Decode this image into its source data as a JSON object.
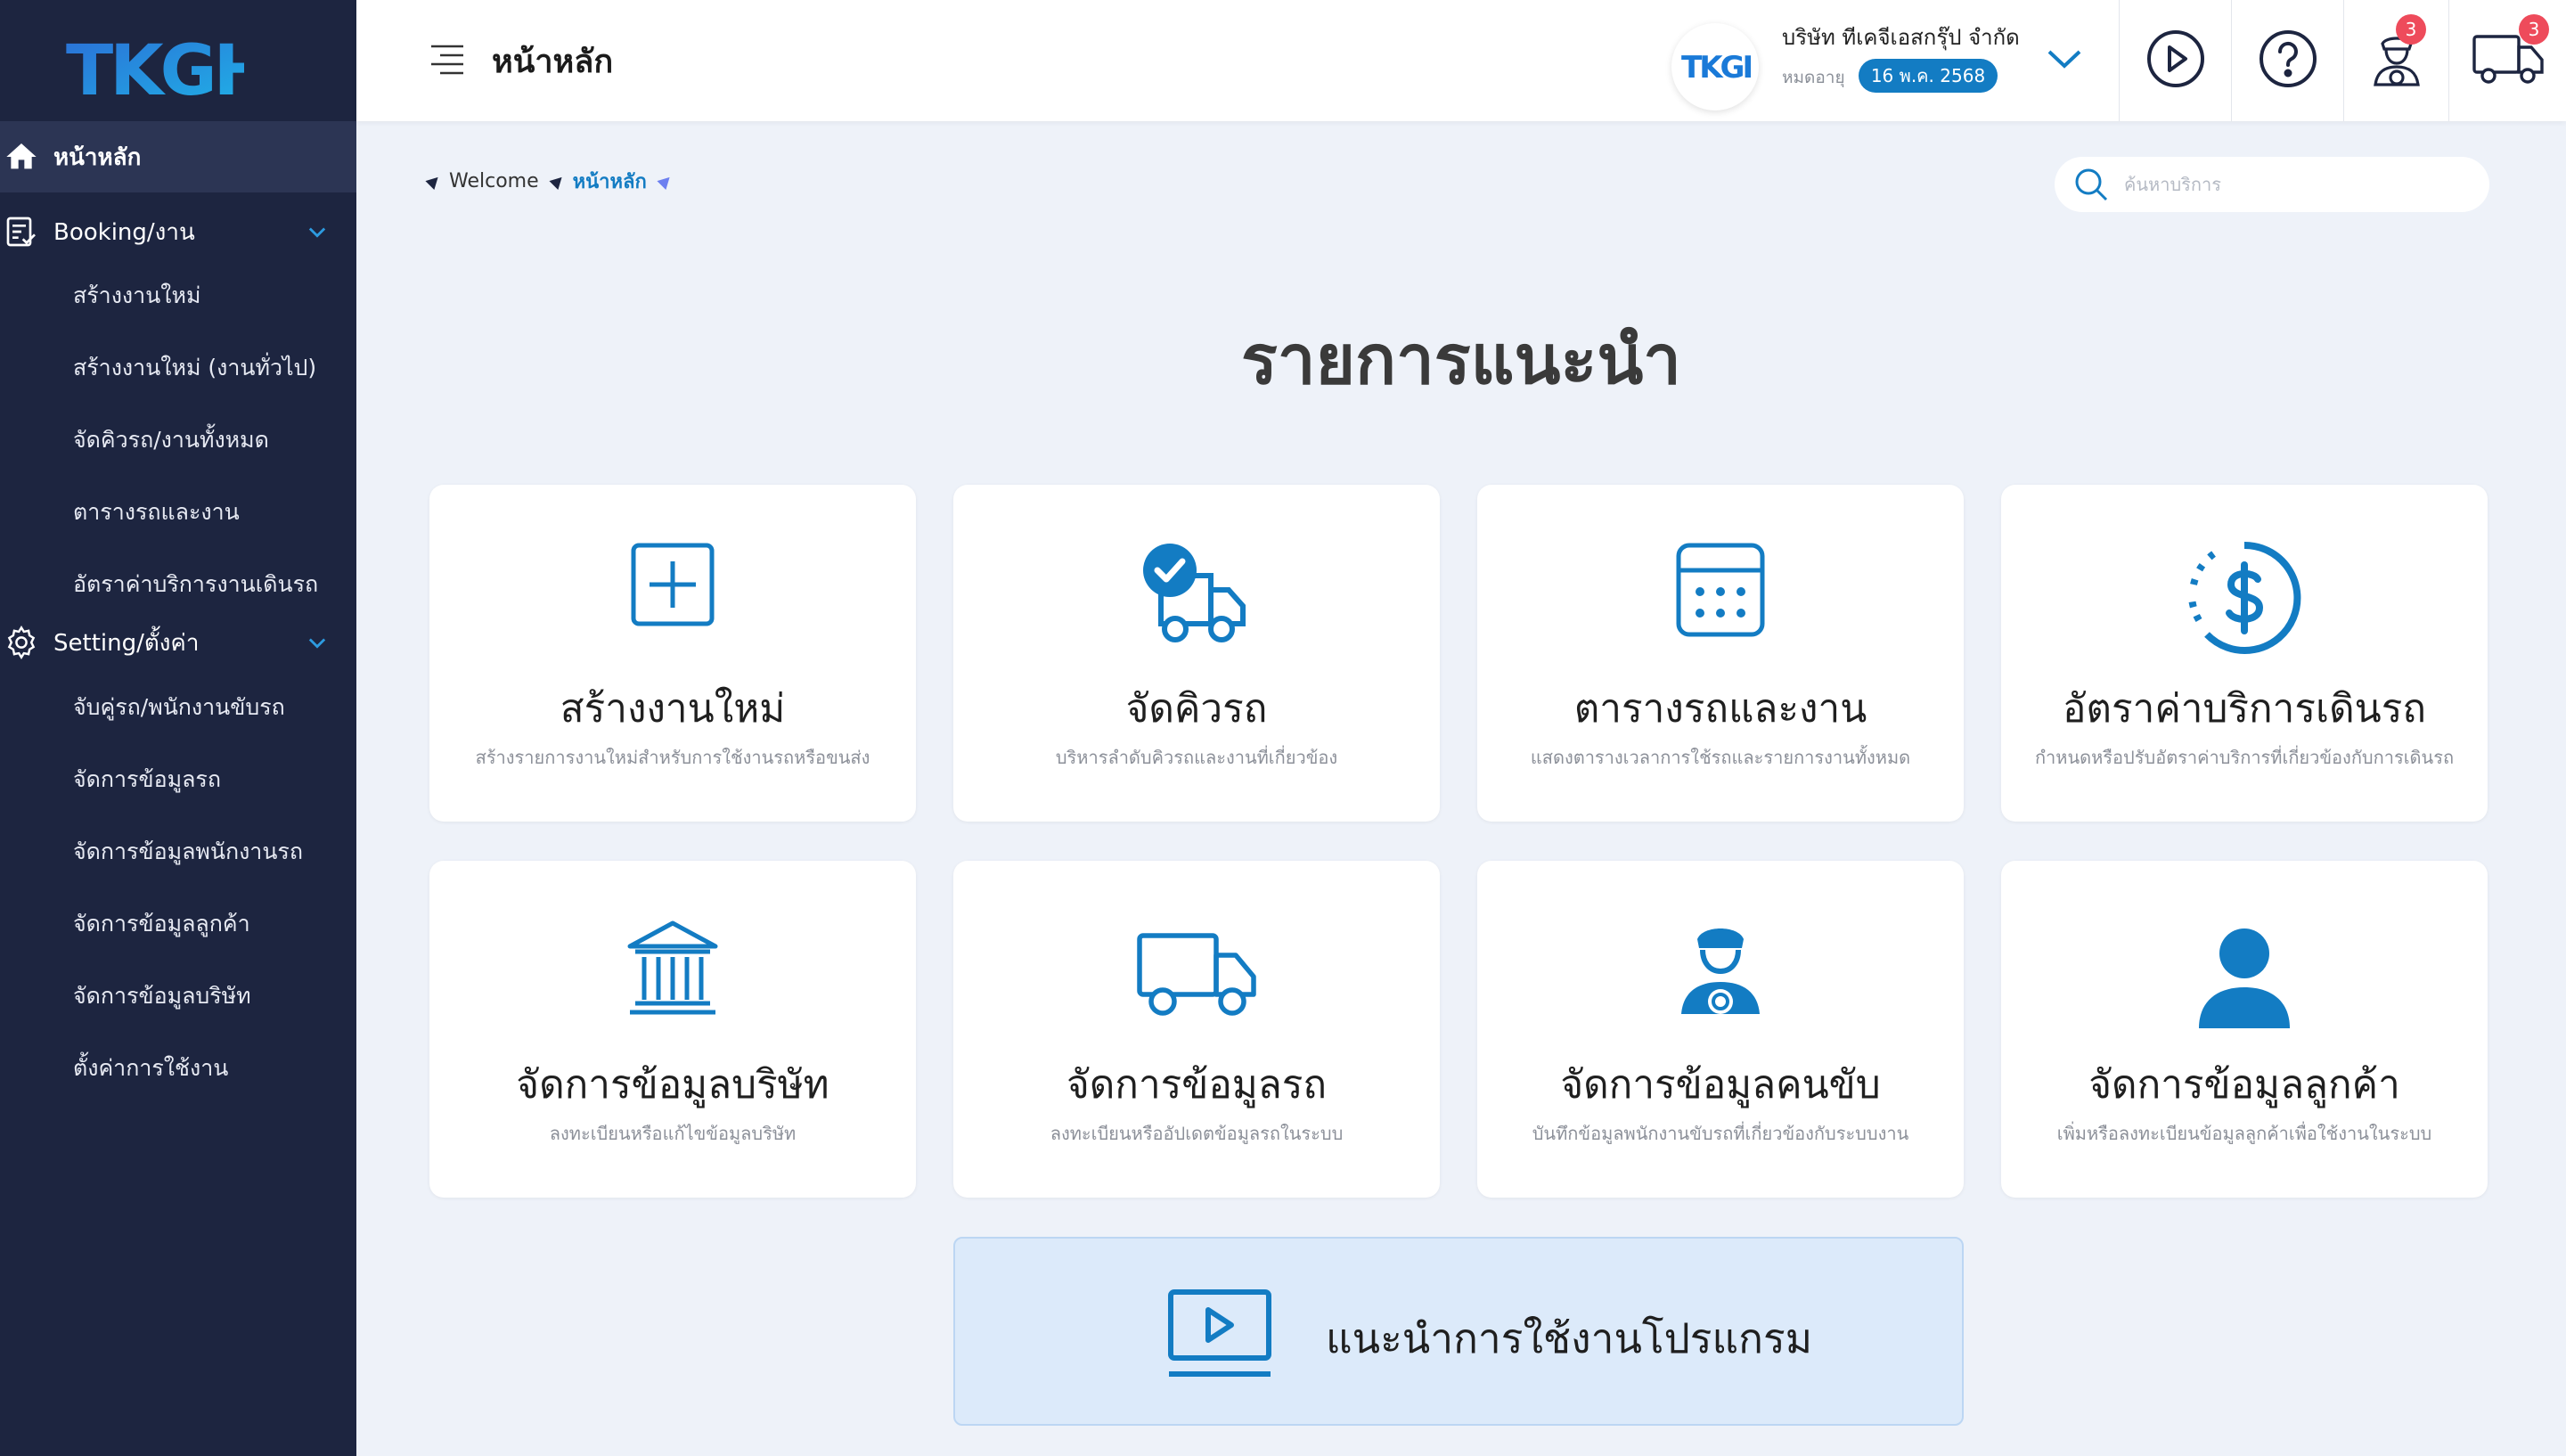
{
  "brand": {
    "logo_text": "TKGH"
  },
  "sidebar": {
    "home": "หน้าหลัก",
    "booking": {
      "label": "Booking/งาน",
      "items": [
        "สร้างงานใหม่",
        "สร้างงานใหม่ (งานทั่วไป)",
        "จัดคิวรถ/งานทั้งหมด",
        "ตารางรถและงาน",
        "อัตราค่าบริการงานเดินรถ"
      ]
    },
    "setting": {
      "label": "Setting/ตั้งค่า",
      "items": [
        "จับคู่รถ/พนักงานขับรถ",
        "จัดการข้อมูลรถ",
        "จัดการข้อมูลพนักงานรถ",
        "จัดการข้อมูลลูกค้า",
        "จัดการข้อมูลบริษัท",
        "ตั้งค่าการใช้งาน"
      ]
    }
  },
  "header": {
    "title": "หน้าหลัก",
    "company_name": "บริษัท ทีเคจีเอสกรุ๊ป จำกัด",
    "expiry_label": "หมดอายุ",
    "expiry_date": "16 พ.ค. 2568",
    "driver_badge": "3",
    "truck_badge": "3"
  },
  "breadcrumb": {
    "first": "Welcome",
    "current": "หน้าหลัก"
  },
  "search": {
    "placeholder": "ค้นหาบริการ",
    "value": ""
  },
  "main": {
    "heading": "รายการแนะนำ",
    "cards": [
      {
        "icon": "plus-square-icon",
        "title": "สร้างงานใหม่",
        "desc": "สร้างรายการงานใหม่สำหรับการใช้งานรถหรือขนส่ง"
      },
      {
        "icon": "truck-check-icon",
        "title": "จัดคิวรถ",
        "desc": "บริหารลำดับคิวรถและงานที่เกี่ยวข้อง"
      },
      {
        "icon": "calendar-icon",
        "title": "ตารางรถและงาน",
        "desc": "แสดงตารางเวลาการใช้รถและรายการงานทั้งหมด"
      },
      {
        "icon": "dollar-circle-icon",
        "title": "อัตราค่าบริการเดินรถ",
        "desc": "กำหนดหรือปรับอัตราค่าบริการที่เกี่ยวข้องกับการเดินรถ"
      },
      {
        "icon": "bank-icon",
        "title": "จัดการข้อมูลบริษัท",
        "desc": "ลงทะเบียนหรือแก้ไขข้อมูลบริษัท"
      },
      {
        "icon": "truck-icon",
        "title": "จัดการข้อมูลรถ",
        "desc": "ลงทะเบียนหรืออัปเดตข้อมูลรถในระบบ"
      },
      {
        "icon": "driver-icon",
        "title": "จัดการข้อมูลคนขับ",
        "desc": "บันทึกข้อมูลพนักงานขับรถที่เกี่ยวข้องกับระบบงาน"
      },
      {
        "icon": "user-icon",
        "title": "จัดการข้อมูลลูกค้า",
        "desc": "เพิ่มหรือลงทะเบียนข้อมูลลูกค้าเพื่อใช้งานในระบบ"
      }
    ],
    "guide": {
      "icon": "video-play-icon",
      "label": "แนะนำการใช้งานโปรแกรม"
    }
  },
  "colors": {
    "sidebar": "#1d2540",
    "accent": "#137cc3",
    "badge": "#ee4b5b",
    "background": "#eef2f9"
  }
}
